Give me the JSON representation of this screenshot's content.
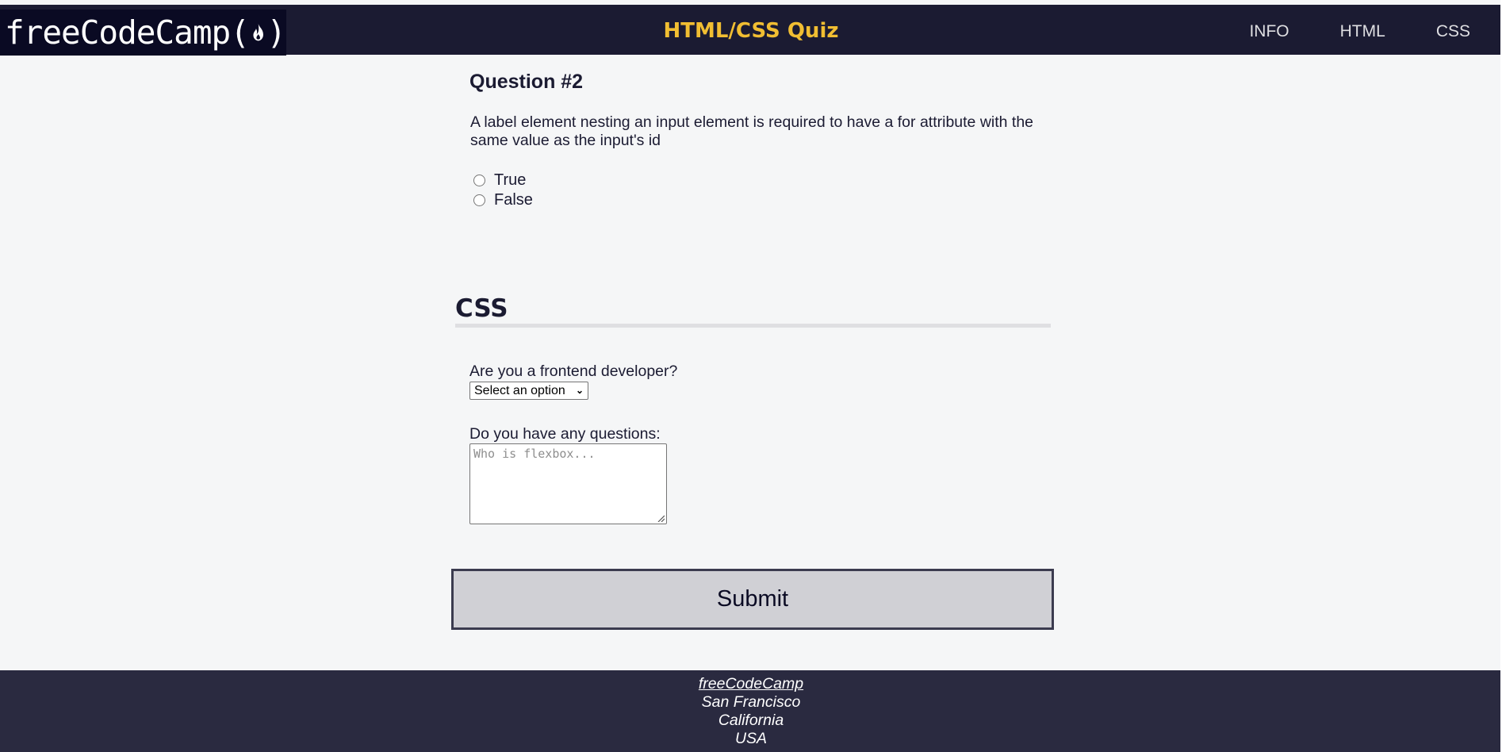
{
  "header": {
    "logo_text": "freeCodeCamp",
    "logo_open_paren": "(",
    "logo_close_paren": ")",
    "title": "HTML/CSS Quiz",
    "nav": [
      {
        "label": "INFO"
      },
      {
        "label": "HTML"
      },
      {
        "label": "CSS"
      }
    ]
  },
  "question": {
    "title": "Question #2",
    "text": "A label element nesting an input element is required to have a for attribute with the same value as the input's id",
    "options": [
      {
        "label": "True"
      },
      {
        "label": "False"
      }
    ]
  },
  "css_section": {
    "heading": "CSS",
    "frontend_label": "Are you a frontend developer?",
    "frontend_select_value": "Select an option",
    "questions_label": "Do you have any questions:",
    "questions_placeholder": "Who is flexbox..."
  },
  "submit_label": "Submit",
  "footer": {
    "link": "freeCodeCamp",
    "city": "San Francisco",
    "state": "California",
    "country": "USA"
  },
  "colors": {
    "header_bg": "#1b1b32",
    "title_accent": "#f1be32",
    "page_bg": "#f5f6f7",
    "footer_bg": "#2a2a40",
    "button_bg": "#d0d0d5"
  }
}
